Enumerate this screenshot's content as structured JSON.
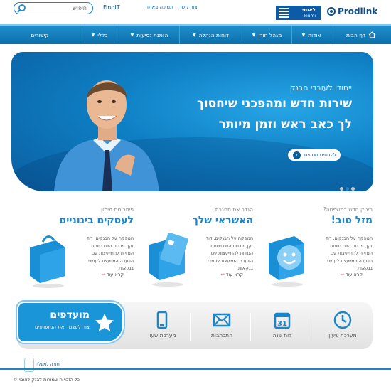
{
  "header": {
    "search_placeholder": "חיפוש",
    "links": [
      "צור קשר",
      "תמיכה באתר"
    ],
    "findit": "FindIT",
    "leumi_logo_text_1": "לאומי",
    "leumi_logo_text_2": "leumi",
    "prodlink_logo": "Prodlink"
  },
  "nav": {
    "items": [
      {
        "label": "דף הבית",
        "icon": "home-icon"
      },
      {
        "label": "אודות"
      },
      {
        "label": "מגהל חורן"
      },
      {
        "label": "דוחות הנהלה"
      },
      {
        "label": "הזמנת נסיעות"
      },
      {
        "label": "כללי"
      },
      {
        "label": "קישורים"
      }
    ]
  },
  "hero": {
    "line1": "ייחודי לעובדי הבנק",
    "line2": "שירות חדש ומהפכני שיחסוך",
    "line3": "לך כאב ראש וזמן מיותר",
    "button": "לפרטים נוספים"
  },
  "promos": [
    {
      "subtitle": "תינוק חדש במשפחה?",
      "title": "מזל טוב!",
      "desc": "המפקח על הבנקים, דוד זקן, פרסם היום טיוטת הנחיות להתייעצות עם הוועדה המייעצת לענייני בנקאות",
      "more": "קרא עוד",
      "icon": "smiley-cube-icon"
    },
    {
      "subtitle": "הגדר את מסגרת",
      "title": "האשראי שלך",
      "desc": "המפקח על הבנקים, דוד זקן, פרסם היום טיוטת הנחיות להתייעצות עם הוועדה המייעצת לענייני בנקאות",
      "more": "קרא עוד",
      "icon": "credit-card-icon"
    },
    {
      "subtitle": "פיתרונות מימון",
      "title": "לעסקים בינוניים",
      "desc": "המפקח על הבנקים, דוד זקן, פרסם היום טיוטת הנחיות להתייעצות עם הוועדה המייעצת לענייני בנקאות",
      "more": "קרא עוד",
      "icon": "shopping-bag-icon"
    }
  ],
  "favorites": {
    "title": "מועדפים",
    "subtitle": "צור לעצמך את המועדפים"
  },
  "quick_links": [
    {
      "label": "מערכת שעון",
      "icon": "clock-icon"
    },
    {
      "label": "לוח שנה",
      "icon": "calendar-icon",
      "day": "31"
    },
    {
      "label": "התכתבות",
      "icon": "envelope-icon"
    },
    {
      "label": "מערכת שעון",
      "icon": "mobile-phone-icon"
    }
  ],
  "footer": {
    "back_to_top": "חזרה למעלה",
    "copyright": "כל הזכויות שמורות לבנק לאומי ©"
  },
  "colors": {
    "brand_blue": "#1a86c8",
    "dark_blue": "#0d4f8a",
    "accent_pink": "#e0409a"
  }
}
